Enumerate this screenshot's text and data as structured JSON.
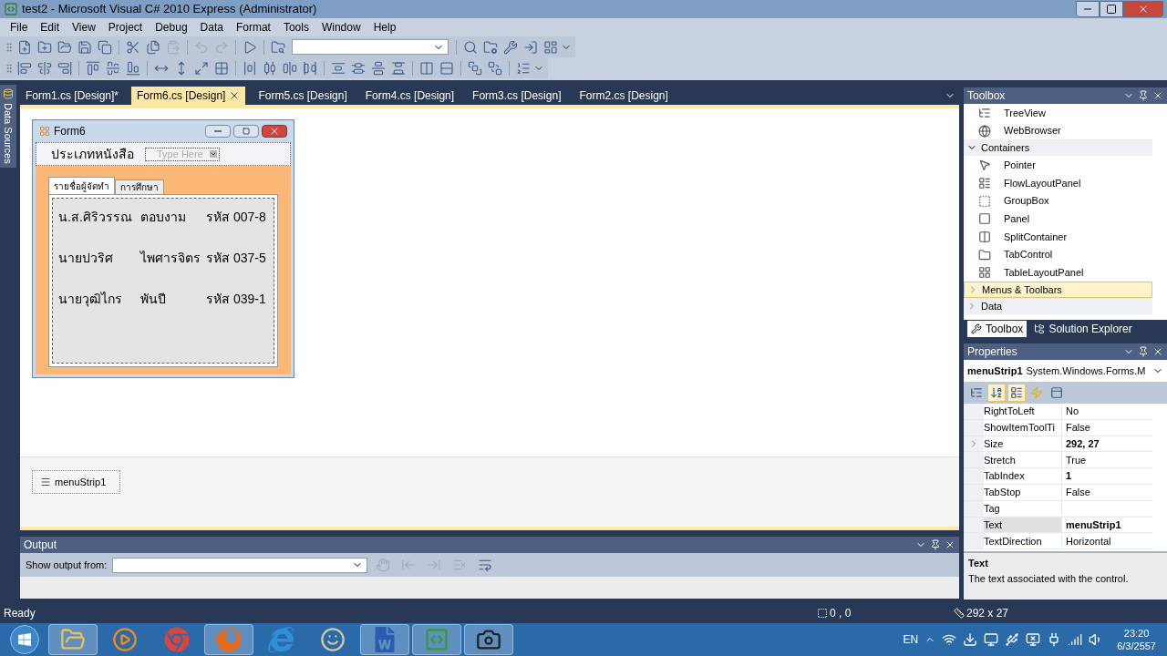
{
  "window": {
    "title": "test2 - Microsoft Visual C# 2010 Express (Administrator)"
  },
  "menu": [
    "File",
    "Edit",
    "View",
    "Project",
    "Debug",
    "Data",
    "Format",
    "Tools",
    "Window",
    "Help"
  ],
  "document_tabs": [
    {
      "label": "Form1.cs [Design]*",
      "selected": false
    },
    {
      "label": "Form6.cs [Design]",
      "selected": true
    },
    {
      "label": "Form5.cs [Design]",
      "selected": false
    },
    {
      "label": "Form4.cs [Design]",
      "selected": false
    },
    {
      "label": "Form3.cs [Design]",
      "selected": false
    },
    {
      "label": "Form2.cs [Design]",
      "selected": false
    }
  ],
  "side_strip": {
    "label": "Data Sources"
  },
  "form": {
    "title": "Form6",
    "menu_item": "ประเภทหนังสือ",
    "type_here": "Type Here",
    "tabs": [
      {
        "label": "รายชื่อผู้จัดทำ",
        "selected": true
      },
      {
        "label": "การศึกษา",
        "selected": false
      }
    ],
    "rows": [
      [
        "น.ส.ศิริวรรณ",
        "ตอบงาม",
        "รหัส 007-8"
      ],
      [
        "นายปวริศ",
        "ไพศารจิตร",
        "รหัส 037-5"
      ],
      [
        "นายวุฒิไกร",
        "พันปี",
        "รหัส 039-1"
      ]
    ]
  },
  "tray_components": [
    "menuStrip1"
  ],
  "toolbox": {
    "title": "Toolbox",
    "items": [
      {
        "kind": "item",
        "label": "TreeView"
      },
      {
        "kind": "item",
        "label": "WebBrowser"
      },
      {
        "kind": "group",
        "label": "Containers",
        "expanded": true,
        "selected": false
      },
      {
        "kind": "item",
        "label": "Pointer"
      },
      {
        "kind": "item",
        "label": "FlowLayoutPanel"
      },
      {
        "kind": "item",
        "label": "GroupBox"
      },
      {
        "kind": "item",
        "label": "Panel"
      },
      {
        "kind": "item",
        "label": "SplitContainer"
      },
      {
        "kind": "item",
        "label": "TabControl"
      },
      {
        "kind": "item",
        "label": "TableLayoutPanel"
      },
      {
        "kind": "group",
        "label": "Menus & Toolbars",
        "expanded": false,
        "selected": true
      },
      {
        "kind": "group",
        "label": "Data",
        "expanded": false,
        "selected": false
      }
    ],
    "footer_tabs": [
      {
        "label": "Toolbox",
        "selected": true
      },
      {
        "label": "Solution Explorer",
        "selected": false
      }
    ]
  },
  "properties": {
    "title": "Properties",
    "object_name": "menuStrip1",
    "object_type": "System.Windows.Forms.M",
    "view_buttons": [
      {
        "selected": false
      },
      {
        "selected": true
      },
      {
        "selected": true
      },
      {
        "selected": false
      },
      {
        "selected": false
      }
    ],
    "rows": [
      {
        "name": "RightToLeft",
        "value": "No",
        "modified": false,
        "expandable": false,
        "selected": false
      },
      {
        "name": "ShowItemToolTi",
        "value": "False",
        "modified": false,
        "expandable": false,
        "selected": false
      },
      {
        "name": "Size",
        "value": "292, 27",
        "modified": true,
        "expandable": true,
        "selected": false
      },
      {
        "name": "Stretch",
        "value": "True",
        "modified": false,
        "expandable": false,
        "selected": false
      },
      {
        "name": "TabIndex",
        "value": "1",
        "modified": true,
        "expandable": false,
        "selected": false
      },
      {
        "name": "TabStop",
        "value": "False",
        "modified": false,
        "expandable": false,
        "selected": false
      },
      {
        "name": "Tag",
        "expandable": false,
        "selected": false
      },
      {
        "name": "Text",
        "value": "menuStrip1",
        "modified": true,
        "expandable": false,
        "selected": true
      },
      {
        "name": "TextDirection",
        "value": "Horizontal",
        "modified": false,
        "expandable": false,
        "selected": false
      }
    ],
    "description": {
      "title": "Text",
      "text": "The text associated with the control."
    }
  },
  "output": {
    "title": "Output",
    "label": "Show output from:"
  },
  "status_bar": {
    "text": "Ready",
    "position": "0 , 0",
    "size": "292 x 27"
  },
  "taskbar": {
    "apps": [
      {
        "kind": "folder",
        "running": true
      },
      {
        "kind": "media",
        "running": false
      },
      {
        "kind": "chrome",
        "running": false
      },
      {
        "kind": "firefox",
        "running": true
      },
      {
        "kind": "ie",
        "running": false
      },
      {
        "kind": "mascot",
        "running": false
      },
      {
        "kind": "word",
        "running": true
      },
      {
        "kind": "csharp",
        "running": true
      },
      {
        "kind": "camera",
        "running": true
      }
    ],
    "language": "EN",
    "time": "23:20",
    "date": "6/3/2557"
  }
}
